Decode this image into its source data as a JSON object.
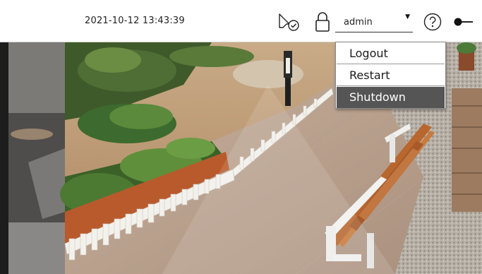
{
  "header": {
    "datetime": "2021-10-12 13:43:39",
    "icons": [
      "event-check-icon",
      "lock-icon",
      "help-icon",
      "toggle-icon"
    ],
    "user": {
      "name": "admin",
      "caret": "▼"
    }
  },
  "user_menu": {
    "items": [
      {
        "label": "Logout"
      },
      {
        "label": "Restart"
      },
      {
        "label": "Shutdown",
        "selected": true
      }
    ],
    "colors": {
      "selected_bg": "#555555",
      "selected_text": "#ffffff"
    }
  },
  "camera": {
    "scene": "garden walkway with wooden bench, white picket fence and lamp post"
  }
}
